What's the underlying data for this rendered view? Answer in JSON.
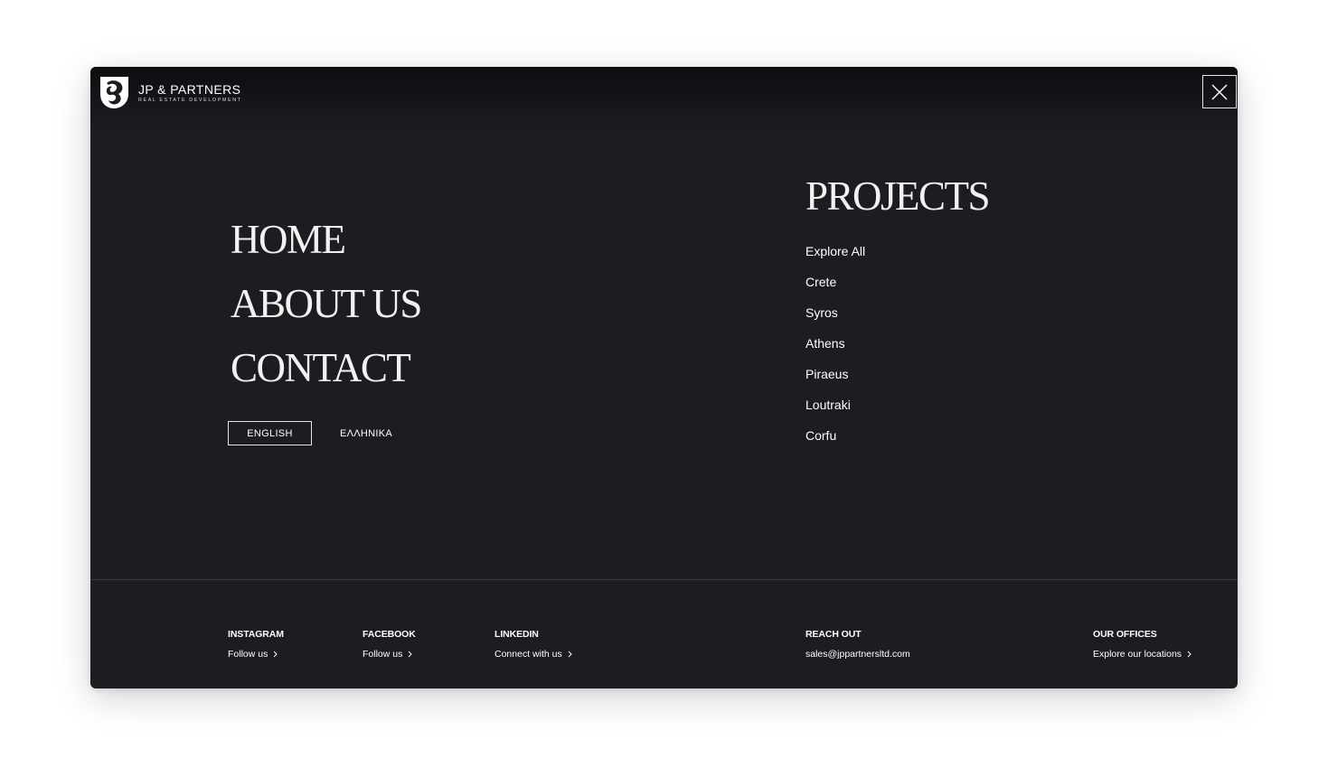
{
  "header": {
    "brand_name": "JP & PARTNERS",
    "brand_tagline": "REAL ESTATE DEVELOPMENT",
    "close_icon": "close-icon"
  },
  "main_nav": {
    "items": [
      {
        "label": "HOME"
      },
      {
        "label": "ABOUT US"
      },
      {
        "label": "CONTACT"
      }
    ]
  },
  "language": {
    "active": "ENGLISH",
    "other": "ΕΛΛΗΝΙΚΑ"
  },
  "projects": {
    "title": "PROJECTS",
    "links": [
      {
        "label": "Explore All"
      },
      {
        "label": "Crete"
      },
      {
        "label": "Syros"
      },
      {
        "label": "Athens"
      },
      {
        "label": "Piraeus"
      },
      {
        "label": "Loutraki"
      },
      {
        "label": "Corfu"
      }
    ]
  },
  "footer": {
    "instagram": {
      "title": "INSTAGRAM",
      "link": "Follow us"
    },
    "facebook": {
      "title": "FACEBOOK",
      "link": "Follow us"
    },
    "linkedin": {
      "title": "LINKEDIN",
      "link": "Connect with us"
    },
    "reach_out": {
      "title": "REACH OUT",
      "link": "sales@jppartnersltd.com"
    },
    "offices": {
      "title": "OUR OFFICES",
      "link": "Explore our locations"
    }
  },
  "colors": {
    "background": "#1d1c21",
    "text": "#ffffff",
    "divider": "#3a3940"
  }
}
